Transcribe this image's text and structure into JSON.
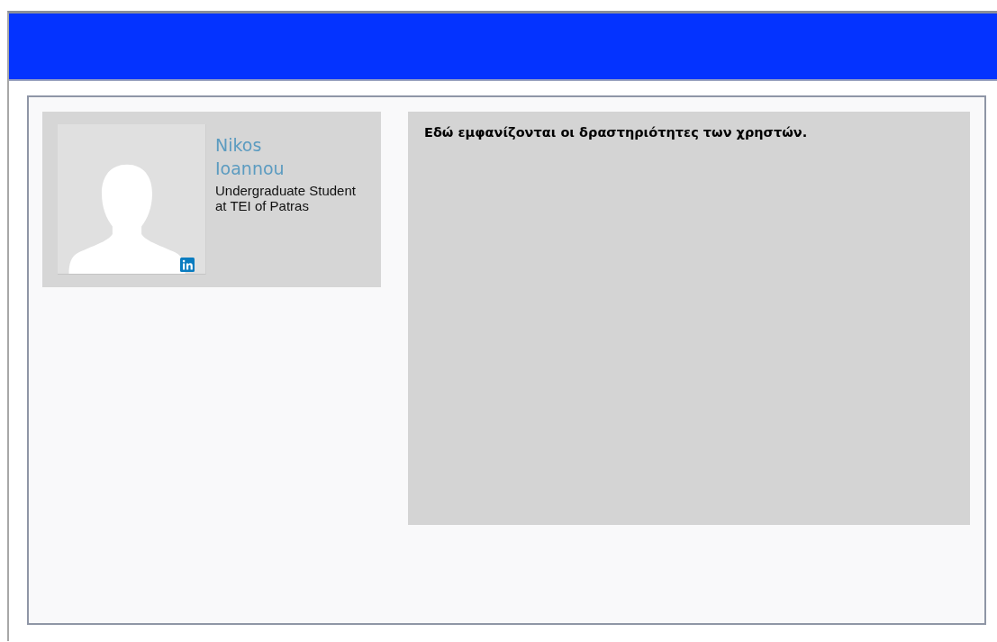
{
  "profile": {
    "name": "Nikos Ioannou",
    "headline": "Undergraduate Student at TEI of Patras",
    "photo": {
      "kind": "placeholder"
    }
  },
  "activity": {
    "text": "Εδώ εμφανίζονται οι δραστηριότητες των χρηστών."
  }
}
